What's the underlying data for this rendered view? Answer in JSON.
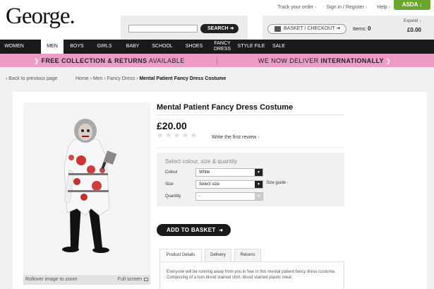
{
  "brand": {
    "logo": "George.",
    "asda_button": "ASDA",
    "asda_arrow": "↓"
  },
  "toplinks": [
    {
      "label": "Track your order"
    },
    {
      "label": "Sign in / Register"
    },
    {
      "label": "Help"
    }
  ],
  "search": {
    "button": "SEARCH",
    "arrow": "➜",
    "placeholder": ""
  },
  "basket": {
    "button": "BASKET / CHECKOUT",
    "arrow": "➜",
    "items_label": "Items:",
    "items_count": "0",
    "expand": "Expand",
    "expand_arrow": "↓",
    "total": "£0.00"
  },
  "nav": [
    "WOMEN",
    "MEN",
    "BOYS",
    "GIRLS",
    "BABY",
    "SCHOOL",
    "SHOES",
    "FANCY DRESS",
    "STYLE FILE",
    "SALE"
  ],
  "promo": {
    "left_bold": "FREE COLLECTION & RETURNS",
    "left_rest": "AVAILABLE",
    "right_rest": "WE NOW DELIVER",
    "right_bold": "INTERNATIONALLY"
  },
  "breadcrumb": {
    "back": "Back to previous page",
    "items": [
      "Home",
      "Men",
      "Fancy Dress"
    ],
    "current": "Mental Patient Fancy Dress Costume"
  },
  "product": {
    "title": "Mental Patient Fancy Dress Costume",
    "price": "£20.00",
    "rating": 0,
    "review_link": "Write the first review",
    "options_title": "Select colour, size & quantity",
    "colour_label": "Colour",
    "colour_value": "White",
    "size_label": "Size",
    "size_value": "Select size",
    "size_guide": "Size guide",
    "quantity_label": "Quantity",
    "quantity_value": "-",
    "add_to_basket": "ADD TO BASKET",
    "zoom_hint": "Rollover image to zoom",
    "full_screen": "Full screen"
  },
  "tabs": [
    "Product Details",
    "Delivery",
    "Returns"
  ],
  "description": "Everyone will be running away from you in fear in this mental patient fancy dress costume. Comprising of a torn blood stained shirt, blood stained plastic meat",
  "colors": {
    "accent_green": "#68a72b",
    "promo_pink": "#ee9cc7",
    "nav_black": "#1a1a1a"
  }
}
